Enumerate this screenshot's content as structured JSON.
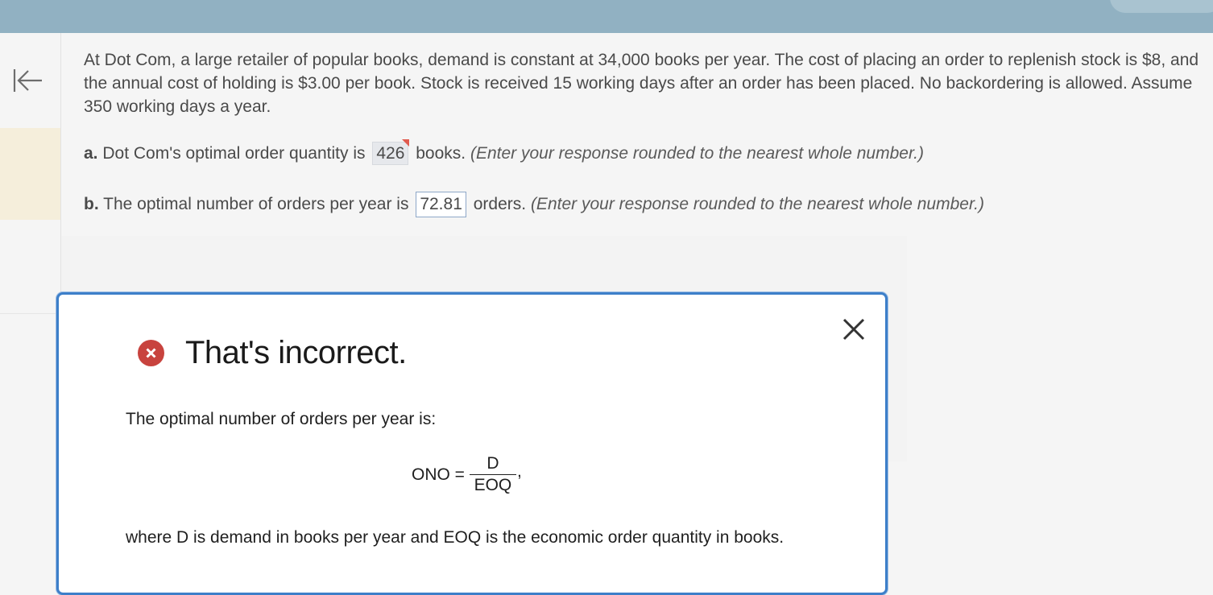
{
  "problem": {
    "text": "At Dot Com, a large retailer of popular books, demand is constant at 34,000 books per year. The cost of placing an order to replenish stock is $8, and the annual cost of holding is $3.00 per book. Stock is received 15 working days after an order has been placed. No backordering is allowed. Assume 350 working days a year."
  },
  "question_a": {
    "label": "a.",
    "prefix": "Dot Com's optimal order quantity is",
    "answer": "426",
    "suffix": "books.",
    "hint": "(Enter your response rounded to the nearest whole number.)"
  },
  "question_b": {
    "label": "b.",
    "prefix": "The optimal number of orders per year is",
    "answer": "72.81",
    "suffix": "orders.",
    "hint": "(Enter your response rounded to the nearest whole number.)"
  },
  "feedback": {
    "status": "That's incorrect.",
    "explanation": "The optimal number of orders per year is:",
    "formula": {
      "lhs": "ONO =",
      "numerator": "D",
      "denominator": "EOQ",
      "trailing": ","
    },
    "where": "where D is demand in books per year and EOQ is the economic order quantity in books."
  },
  "icons": {
    "collapse": "collapse-left-icon",
    "error": "error-x-icon",
    "close": "close-icon"
  },
  "colors": {
    "topbar": "#91b1c2",
    "dialog_border": "#3d7fc9",
    "error_red": "#c8433e",
    "rail_highlight": "#f5eedb"
  }
}
